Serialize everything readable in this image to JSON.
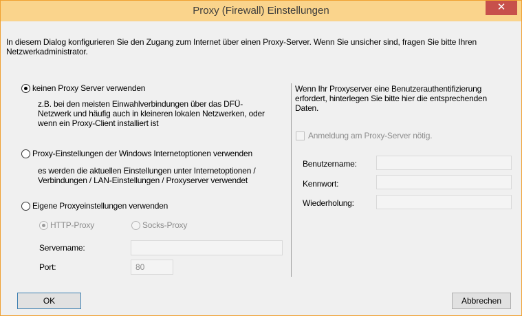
{
  "window": {
    "title": "Proxy (Firewall) Einstellungen",
    "close_glyph": "✕"
  },
  "intro": "In diesem Dialog konfigurieren Sie den Zugang zum Internet über einen Proxy-Server. Wenn Sie unsicher sind, fragen Sie bitte Ihren Netzwerkadministrator.",
  "options": [
    {
      "label": "keinen Proxy Server verwenden",
      "selected": true,
      "description": "z.B. bei den meisten Einwahlverbindungen über das DFÜ-Netzwerk und häufig auch in kleineren lokalen Netzwerken, oder wenn ein Proxy-Client installiert ist"
    },
    {
      "label": "Proxy-Einstellungen der Windows Internetoptionen verwenden",
      "selected": false,
      "description": "es werden die aktuellen Einstellungen unter Internetoptionen / Verbindungen / LAN-Einstellungen / Proxyserver verwendet"
    },
    {
      "label": "Eigene Proxyeinstellungen verwenden",
      "selected": false
    }
  ],
  "own_proxy": {
    "http_label": "HTTP-Proxy",
    "socks_label": "Socks-Proxy",
    "servername_label": "Servername:",
    "servername_value": "",
    "port_label": "Port:",
    "port_value": "80"
  },
  "auth": {
    "info": "Wenn Ihr Proxyserver eine Benutzerauthentifizierung erfordert, hinterlegen Sie bitte hier die entsprechenden Daten.",
    "checkbox_label": "Anmeldung am Proxy-Server nötig.",
    "username_label": "Benutzername:",
    "password_label": "Kennwort:",
    "repeat_label": "Wiederholung:",
    "username_value": "",
    "password_value": "",
    "repeat_value": ""
  },
  "buttons": {
    "ok": "OK",
    "cancel": "Abbrechen"
  }
}
